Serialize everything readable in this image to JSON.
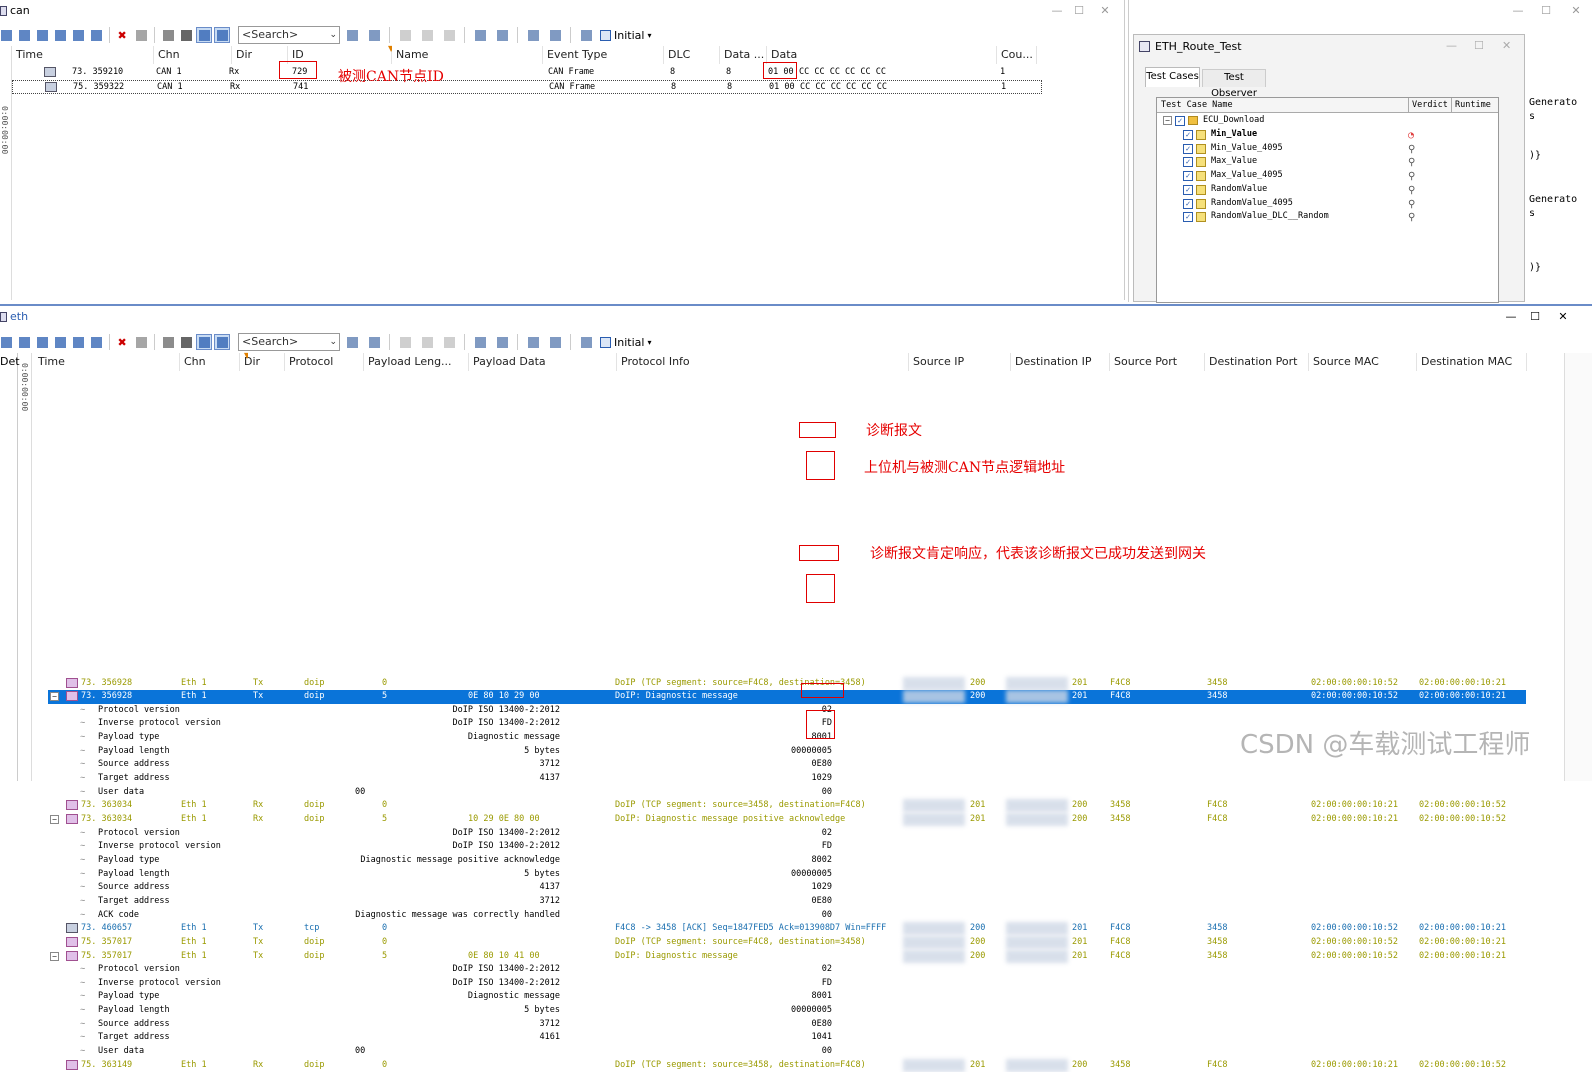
{
  "can_window": {
    "title": "can",
    "search_placeholder": "<Search>",
    "initial_label": "Initial",
    "columns": [
      "Time",
      "Chn",
      "Dir",
      "ID",
      "Name",
      "Event Type",
      "DLC",
      "Data ...",
      "Data",
      "Cou..."
    ],
    "rows": [
      {
        "time": "73. 359210",
        "chn": "CAN 1",
        "dir": "Rx",
        "id": "729",
        "event": "CAN Frame",
        "dlc": "8",
        "datalen": "8",
        "data_a": "01 00",
        "data_b": "CC CC CC CC CC CC",
        "count": "1"
      },
      {
        "time": "75. 359322",
        "chn": "CAN 1",
        "dir": "Rx",
        "id": "741",
        "event": "CAN Frame",
        "dlc": "8",
        "datalen": "8",
        "data_a": "01 00",
        "data_b": "CC CC CC CC CC CC",
        "count": "1"
      }
    ],
    "annotation_id": "被测CAN节点ID"
  },
  "eth_route_test": {
    "title": "ETH_Route_Test",
    "tabs": [
      "Test Cases",
      "Test Observer"
    ],
    "columns": [
      "Test Case Name",
      "Verdict",
      "Runtime"
    ],
    "group": "ECU_Download",
    "cases": [
      "Min_Value",
      "Min_Value_4095",
      "Max_Value",
      "Max_Value_4095",
      "RandomValue",
      "RandomValue_4095",
      "RandomValue_DLC__Random"
    ],
    "side_texts": [
      "Generato",
      "s",
      ")}",
      "Generato",
      "s",
      ")}"
    ]
  },
  "eth_window": {
    "title": "eth",
    "search_placeholder": "<Search>",
    "initial_label": "Initial",
    "left_cut": "Det",
    "columns": [
      "Time",
      "Chn",
      "Dir",
      "Protocol",
      "Payload Leng...",
      "Payload Data",
      "Protocol Info",
      "Source IP",
      "Destination IP",
      "Source Port",
      "Destination Port",
      "Source MAC",
      "Destination MAC"
    ],
    "rows": [
      {
        "kind": "frame",
        "color": "olive",
        "time": "73. 356928",
        "chn": "Eth 1",
        "dir": "Tx",
        "proto": "doip",
        "plen": "0",
        "pdata": "",
        "info": "DoIP (TCP segment: source=F4C8, destination=3458)",
        "sip": "200",
        "dip": "201",
        "sport": "F4C8",
        "dport": "3458",
        "smac": "02:00:00:00:10:52",
        "dmac": "02:00:00:00:10:21"
      },
      {
        "kind": "frame",
        "color": "sel",
        "expanded": true,
        "time": "73. 356928",
        "chn": "Eth 1",
        "dir": "Tx",
        "proto": "doip",
        "plen": "5",
        "pdata": "0E 80 10 29 00",
        "info": "DoIP: Diagnostic message",
        "sip": "200",
        "dip": "201",
        "sport": "F4C8",
        "dport": "3458",
        "smac": "02:00:00:00:10:52",
        "dmac": "02:00:00:00:10:21"
      },
      {
        "kind": "field",
        "name": "Protocol version",
        "val": "DoIP ISO 13400-2:2012",
        "raw": "02"
      },
      {
        "kind": "field",
        "name": "Inverse protocol version",
        "val": "DoIP ISO 13400-2:2012",
        "raw": "FD"
      },
      {
        "kind": "field",
        "name": "Payload type",
        "val": "Diagnostic message",
        "raw": "8001"
      },
      {
        "kind": "field",
        "name": "Payload length",
        "val": "5 bytes",
        "raw": "00000005"
      },
      {
        "kind": "field",
        "name": "Source address",
        "val": "3712",
        "raw": "0E80"
      },
      {
        "kind": "field",
        "name": "Target address",
        "val": "4137",
        "raw": "1029"
      },
      {
        "kind": "field",
        "name": "User data",
        "val": "00",
        "raw": "00",
        "valpos": "left"
      },
      {
        "kind": "frame",
        "color": "olive",
        "time": "73. 363034",
        "chn": "Eth 1",
        "dir": "Rx",
        "proto": "doip",
        "plen": "0",
        "pdata": "",
        "info": "DoIP (TCP segment: source=3458, destination=F4C8)",
        "sip": "201",
        "dip": "200",
        "sport": "3458",
        "dport": "F4C8",
        "smac": "02:00:00:00:10:21",
        "dmac": "02:00:00:00:10:52"
      },
      {
        "kind": "frame",
        "color": "olive",
        "expanded": true,
        "time": "73. 363034",
        "chn": "Eth 1",
        "dir": "Rx",
        "proto": "doip",
        "plen": "5",
        "pdata": "10 29 0E 80 00",
        "info": "DoIP: Diagnostic message positive acknowledge",
        "sip": "201",
        "dip": "200",
        "sport": "3458",
        "dport": "F4C8",
        "smac": "02:00:00:00:10:21",
        "dmac": "02:00:00:00:10:52"
      },
      {
        "kind": "field",
        "name": "Protocol version",
        "val": "DoIP ISO 13400-2:2012",
        "raw": "02"
      },
      {
        "kind": "field",
        "name": "Inverse protocol version",
        "val": "DoIP ISO 13400-2:2012",
        "raw": "FD"
      },
      {
        "kind": "field",
        "name": "Payload type",
        "val": "Diagnostic message positive acknowledge",
        "raw": "8002"
      },
      {
        "kind": "field",
        "name": "Payload length",
        "val": "5 bytes",
        "raw": "00000005"
      },
      {
        "kind": "field",
        "name": "Source address",
        "val": "4137",
        "raw": "1029"
      },
      {
        "kind": "field",
        "name": "Target address",
        "val": "3712",
        "raw": "0E80"
      },
      {
        "kind": "field",
        "name": "ACK code",
        "val": "Diagnostic message was correctly handled",
        "raw": "00"
      },
      {
        "kind": "frame",
        "color": "blue",
        "time": "73. 460657",
        "chn": "Eth 1",
        "dir": "Tx",
        "proto": "tcp",
        "plen": "0",
        "pdata": "",
        "info": "F4C8 -> 3458 [ACK] Seq=1847FED5 Ack=013908D7 Win=FFFF",
        "sip": "200",
        "dip": "201",
        "sport": "F4C8",
        "dport": "3458",
        "smac": "02:00:00:00:10:52",
        "dmac": "02:00:00:00:10:21"
      },
      {
        "kind": "frame",
        "color": "olive",
        "time": "75. 357017",
        "chn": "Eth 1",
        "dir": "Tx",
        "proto": "doip",
        "plen": "0",
        "pdata": "",
        "info": "DoIP (TCP segment: source=F4C8, destination=3458)",
        "sip": "200",
        "dip": "201",
        "sport": "F4C8",
        "dport": "3458",
        "smac": "02:00:00:00:10:52",
        "dmac": "02:00:00:00:10:21"
      },
      {
        "kind": "frame",
        "color": "olive",
        "expanded": true,
        "time": "75. 357017",
        "chn": "Eth 1",
        "dir": "Tx",
        "proto": "doip",
        "plen": "5",
        "pdata": "0E 80 10 41 00",
        "info": "DoIP: Diagnostic message",
        "sip": "200",
        "dip": "201",
        "sport": "F4C8",
        "dport": "3458",
        "smac": "02:00:00:00:10:52",
        "dmac": "02:00:00:00:10:21"
      },
      {
        "kind": "field",
        "name": "Protocol version",
        "val": "DoIP ISO 13400-2:2012",
        "raw": "02"
      },
      {
        "kind": "field",
        "name": "Inverse protocol version",
        "val": "DoIP ISO 13400-2:2012",
        "raw": "FD"
      },
      {
        "kind": "field",
        "name": "Payload type",
        "val": "Diagnostic message",
        "raw": "8001"
      },
      {
        "kind": "field",
        "name": "Payload length",
        "val": "5 bytes",
        "raw": "00000005"
      },
      {
        "kind": "field",
        "name": "Source address",
        "val": "3712",
        "raw": "0E80"
      },
      {
        "kind": "field",
        "name": "Target address",
        "val": "4161",
        "raw": "1041"
      },
      {
        "kind": "field",
        "name": "User data",
        "val": "00",
        "raw": "00",
        "valpos": "left"
      },
      {
        "kind": "frame",
        "color": "olive",
        "time": "75. 363149",
        "chn": "Eth 1",
        "dir": "Rx",
        "proto": "doip",
        "plen": "0",
        "pdata": "",
        "info": "DoIP (TCP segment: source=3458, destination=F4C8)",
        "sip": "201",
        "dip": "200",
        "sport": "3458",
        "dport": "F4C8",
        "smac": "02:00:00:00:10:21",
        "dmac": "02:00:00:00:10:52"
      }
    ],
    "annotations": {
      "diag_msg": "诊断报文",
      "logic_addr": "上位机与被测CAN节点逻辑地址",
      "positive_ack": "诊断报文肯定响应，代表该诊断报文已成功发送到网关"
    }
  },
  "watermark": "CSDN @车载测试工程师"
}
